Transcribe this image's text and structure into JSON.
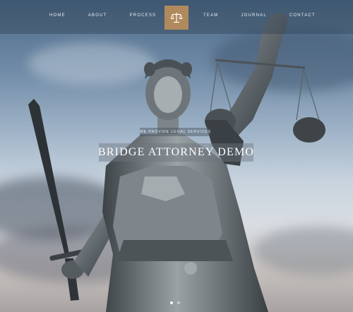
{
  "nav": {
    "left": [
      "HOME",
      "ABOUT",
      "PROCESS"
    ],
    "right": [
      "TEAM",
      "JOURNAL",
      "CONTACT"
    ]
  },
  "logo": {
    "icon": "scales-of-justice-icon",
    "color": "#b08a5c"
  },
  "hero": {
    "tagline": "WE PROVIDE LEGAL SERVICES",
    "title": "BRIDGE ATTORNEY DEMO",
    "slide_count": 2,
    "active_slide": 1
  }
}
